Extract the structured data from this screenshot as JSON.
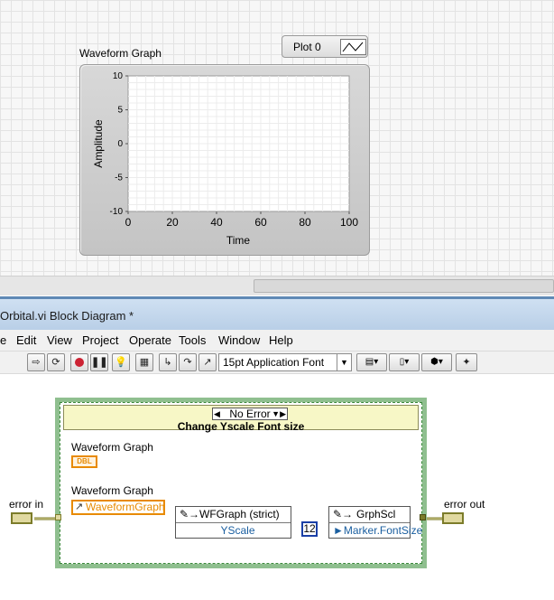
{
  "front_panel": {
    "graph_caption": "Waveform Graph",
    "plot_legend": {
      "label": "Plot 0"
    },
    "graph": {
      "y_label": "Amplitude",
      "x_label": "Time",
      "y_ticks": [
        "10",
        "5",
        "0",
        "-5",
        "-10"
      ],
      "x_ticks": [
        "0",
        "20",
        "40",
        "60",
        "80",
        "100"
      ],
      "x_range": [
        0,
        100
      ],
      "y_range": [
        -10,
        10
      ]
    }
  },
  "block_diagram": {
    "window_title": "Orbital.vi Block Diagram *",
    "menu": [
      "e",
      "Edit",
      "View",
      "Project",
      "Operate",
      "Tools",
      "Window",
      "Help"
    ],
    "toolbar": {
      "font_label": "15pt Application Font"
    },
    "case_structure": {
      "selector": "No Error",
      "title": "Change Yscale Font size"
    },
    "labels": {
      "waveform_graph_1": "Waveform Graph",
      "dbl_terminal": "DBL",
      "waveform_graph_2": "Waveform Graph",
      "ref_terminal": "WaveformGraph",
      "error_in": "error in",
      "error_out": "error out"
    },
    "wf_node": {
      "class": "WFGraph (strict)",
      "property": "YScale"
    },
    "gs_node": {
      "class": "GrphScl",
      "property": "Marker.FontSize"
    },
    "constant": "12",
    "colors": {
      "case_border": "#8fbf8f",
      "ref_wire": "#e88a00",
      "ref_class_wire": "#3a8a8a",
      "error_wire": "#7c7c2a",
      "int_wire": "#1a3fa6"
    }
  }
}
